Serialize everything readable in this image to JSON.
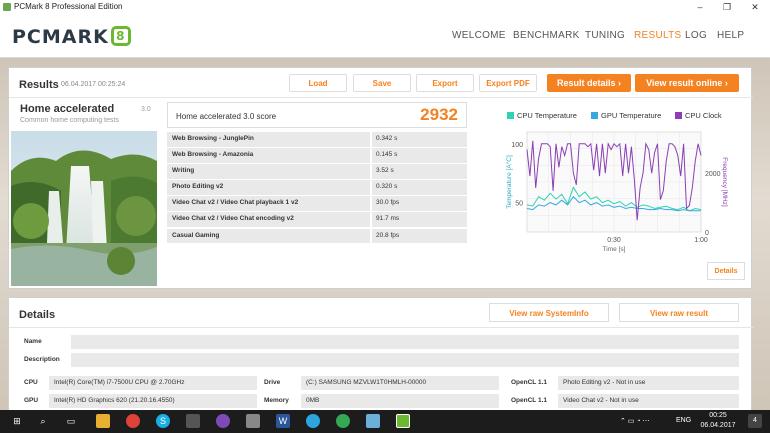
{
  "window": {
    "title": "PCMark 8 Professional Edition",
    "controls": [
      "–",
      "❐",
      "✕"
    ]
  },
  "brand": {
    "logo_text": "PCMARK",
    "logo_badge": "8"
  },
  "nav": {
    "items": [
      {
        "label": "WELCOME",
        "active": false
      },
      {
        "label": "BENCHMARK",
        "active": false
      },
      {
        "label": "TUNING",
        "active": false
      },
      {
        "label": "RESULTS",
        "active": true
      },
      {
        "label": "LOG",
        "active": false
      },
      {
        "label": "HELP",
        "active": false
      }
    ]
  },
  "results": {
    "title": "Results",
    "date": "06.04.2017 00:25:24",
    "buttons": {
      "load": "Load",
      "save": "Save",
      "export": "Export",
      "export_pdf": "Export PDF",
      "result_details": "Result details ›",
      "view_online": "View result online ›"
    },
    "benchmark": {
      "name": "Home accelerated",
      "version": "3.0",
      "description": "Common home computing tests"
    },
    "score": {
      "label": "Home accelerated 3.0 score",
      "value": "2932"
    },
    "metrics": [
      {
        "name": "Web Browsing - JunglePin",
        "value": "0.342 s"
      },
      {
        "name": "Web Browsing - Amazonia",
        "value": "0.145 s"
      },
      {
        "name": "Writing",
        "value": "3.52 s"
      },
      {
        "name": "Photo Editing v2",
        "value": "0.320 s"
      },
      {
        "name": "Video Chat v2 / Video Chat playback 1 v2",
        "value": "30.0 fps"
      },
      {
        "name": "Video Chat v2 / Video Chat encoding v2",
        "value": "91.7 ms"
      },
      {
        "name": "Casual Gaming",
        "value": "20.8 fps"
      }
    ],
    "graph_details_button": "Details"
  },
  "chart_data": {
    "type": "line",
    "legend": [
      "CPU Temperature",
      "GPU Temperature",
      "CPU Clock"
    ],
    "colors": {
      "cpu_temp": "#2fd3b4",
      "gpu_temp": "#3aa8e0",
      "cpu_clock": "#8a3fb5"
    },
    "y_left_label": "Temperature [A°C]",
    "y_left_ticks": [
      "100",
      "50"
    ],
    "y_right_label": "Frequency [MHz]",
    "y_right_ticks": [
      "2000",
      "0"
    ],
    "x_label": "Time [s]",
    "x_ticks": [
      "0:30",
      "1:00"
    ],
    "ylim_left": [
      25,
      110
    ],
    "ylim_right": [
      0,
      3400
    ],
    "xlim": [
      0,
      60
    ],
    "grid": true,
    "legend_position": "top",
    "series": [
      {
        "key": "cpu_temp",
        "x": [
          0,
          2,
          4,
          6,
          8,
          10,
          12,
          14,
          16,
          18,
          20,
          22,
          24,
          26,
          28,
          30,
          32,
          34,
          36,
          38,
          40,
          42,
          44,
          46,
          48,
          50,
          52,
          54,
          56,
          58,
          60
        ],
        "values": [
          48,
          47,
          55,
          52,
          58,
          53,
          57,
          49,
          63,
          55,
          59,
          53,
          55,
          50,
          52,
          49,
          51,
          47,
          50,
          46,
          48,
          47,
          45,
          46,
          47,
          45,
          44,
          46,
          43,
          45,
          44
        ]
      },
      {
        "key": "gpu_temp",
        "x": [
          0,
          2,
          4,
          6,
          8,
          10,
          12,
          14,
          16,
          18,
          20,
          22,
          24,
          26,
          28,
          30,
          32,
          34,
          36,
          38,
          40,
          42,
          44,
          46,
          48,
          50,
          52,
          54,
          56,
          58,
          60
        ],
        "values": [
          45,
          44,
          48,
          47,
          50,
          48,
          52,
          48,
          55,
          50,
          52,
          48,
          50,
          47,
          48,
          46,
          47,
          45,
          46,
          45,
          45,
          44,
          44,
          45,
          44,
          44,
          43,
          44,
          43,
          43,
          43
        ]
      },
      {
        "key": "cpu_clock",
        "x": [
          0,
          1,
          2,
          3,
          4,
          5,
          6,
          7,
          8,
          9,
          10,
          11,
          12,
          13,
          14,
          15,
          16,
          17,
          18,
          19,
          20,
          21,
          22,
          23,
          24,
          25,
          26,
          27,
          28,
          29,
          30,
          31,
          32,
          33,
          34,
          35,
          36,
          37,
          38,
          39,
          40,
          41,
          42,
          43,
          44,
          45,
          46,
          47,
          48,
          49,
          50,
          51,
          52,
          53,
          54,
          55,
          56,
          57,
          58,
          59,
          60
        ],
        "values": [
          2800,
          1900,
          3100,
          1500,
          2500,
          3000,
          3000,
          3000,
          2900,
          1400,
          3000,
          2200,
          2900,
          2600,
          3000,
          3000,
          2000,
          1600,
          3000,
          3000,
          3000,
          2900,
          3000,
          2100,
          3000,
          1900,
          3000,
          2000,
          3000,
          2800,
          3000,
          2900,
          3000,
          1900,
          3000,
          2000,
          2900,
          1800,
          400,
          1500,
          2000,
          3000,
          2800,
          2000,
          2700,
          3000,
          1100,
          1400,
          2400,
          3000,
          3000,
          2900,
          2600,
          1900,
          3000,
          800,
          900,
          1500,
          2400,
          3000,
          2600
        ]
      }
    ]
  },
  "details": {
    "title": "Details",
    "buttons": {
      "sysinfo": "View raw SystemInfo",
      "raw_result": "View raw result"
    },
    "rows": {
      "name": {
        "label": "Name",
        "value": ""
      },
      "description": {
        "label": "Description",
        "value": ""
      },
      "cpu": {
        "label": "CPU",
        "value": "Intel(R) Core(TM) i7-7500U CPU @ 2.70GHz"
      },
      "gpu": {
        "label": "GPU",
        "value": "Intel(R) HD Graphics 620 (21.20.16.4550)"
      },
      "drive": {
        "label": "Drive",
        "value": "(C:) SAMSUNG MZVLW1T0HMLH-00000"
      },
      "memory": {
        "label": "Memory",
        "value": "0MB"
      },
      "opencl1": {
        "label": "OpenCL 1.1",
        "value": "Photo Editing v2 - Not in use"
      },
      "opencl2": {
        "label": "OpenCL 1.1",
        "value": "Video Chat v2 - Not in use"
      }
    }
  },
  "taskbar": {
    "lang": "ENG",
    "time": "00:25",
    "date": "06.04.2017",
    "notif_count": "4"
  }
}
